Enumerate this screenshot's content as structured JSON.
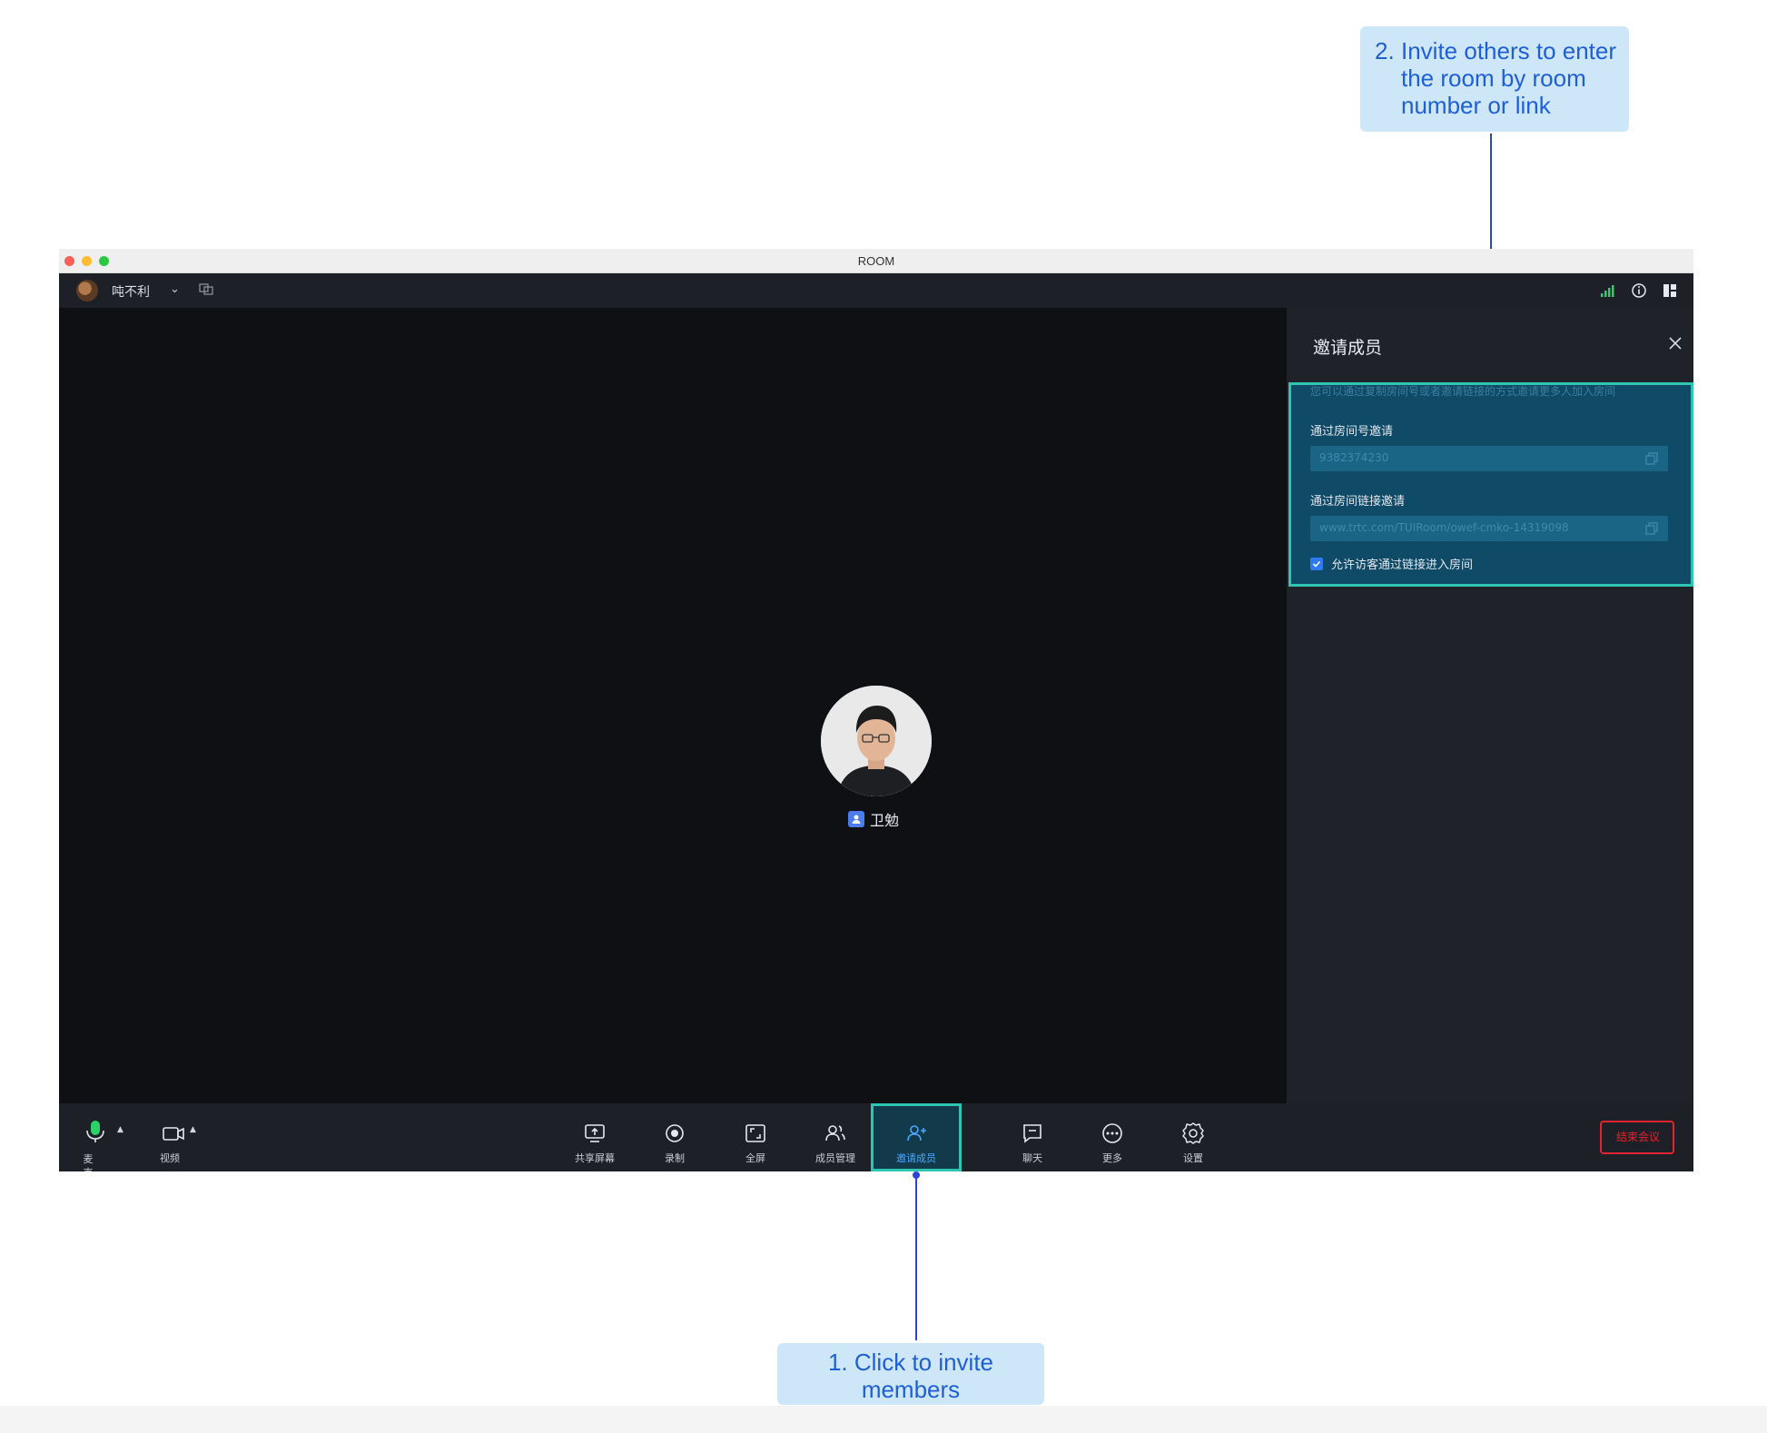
{
  "callouts": {
    "invite_room_num": "2.",
    "invite_room_text": "Invite others to enter the room by room number or link",
    "click_invite": "1. Click to invite members"
  },
  "window": {
    "title": "ROOM"
  },
  "topbar": {
    "user_name": "吨不利"
  },
  "video": {
    "participant_name": "卫勉"
  },
  "invite_panel": {
    "title": "邀请成员",
    "description": "您可以通过复制房间号或者邀请链接的方式邀请更多人加入房间",
    "room_number_label": "通过房间号邀请",
    "room_number": "9382374230",
    "room_link_label": "通过房间链接邀请",
    "room_link": "www.trtc.com/TUIRoom/owef-cmko-14319098",
    "allow_guest_label": "允许访客通过链接进入房间",
    "allow_guest_checked": true
  },
  "toolbar": {
    "mic_label": "麦克风",
    "video_label": "视频",
    "share_label": "共享屏幕",
    "record_label": "录制",
    "fullscreen_label": "全屏",
    "members_label": "成员管理",
    "invite_label": "邀请成员",
    "chat_label": "聊天",
    "more_label": "更多",
    "settings_label": "设置",
    "end_label": "结束会议"
  },
  "colors": {
    "accent_teal": "#2fc6b1",
    "callout_bg": "#cde7f8",
    "callout_text": "#1f5fd6",
    "end_red": "#e3232f",
    "mic_green": "#2ed06a"
  }
}
